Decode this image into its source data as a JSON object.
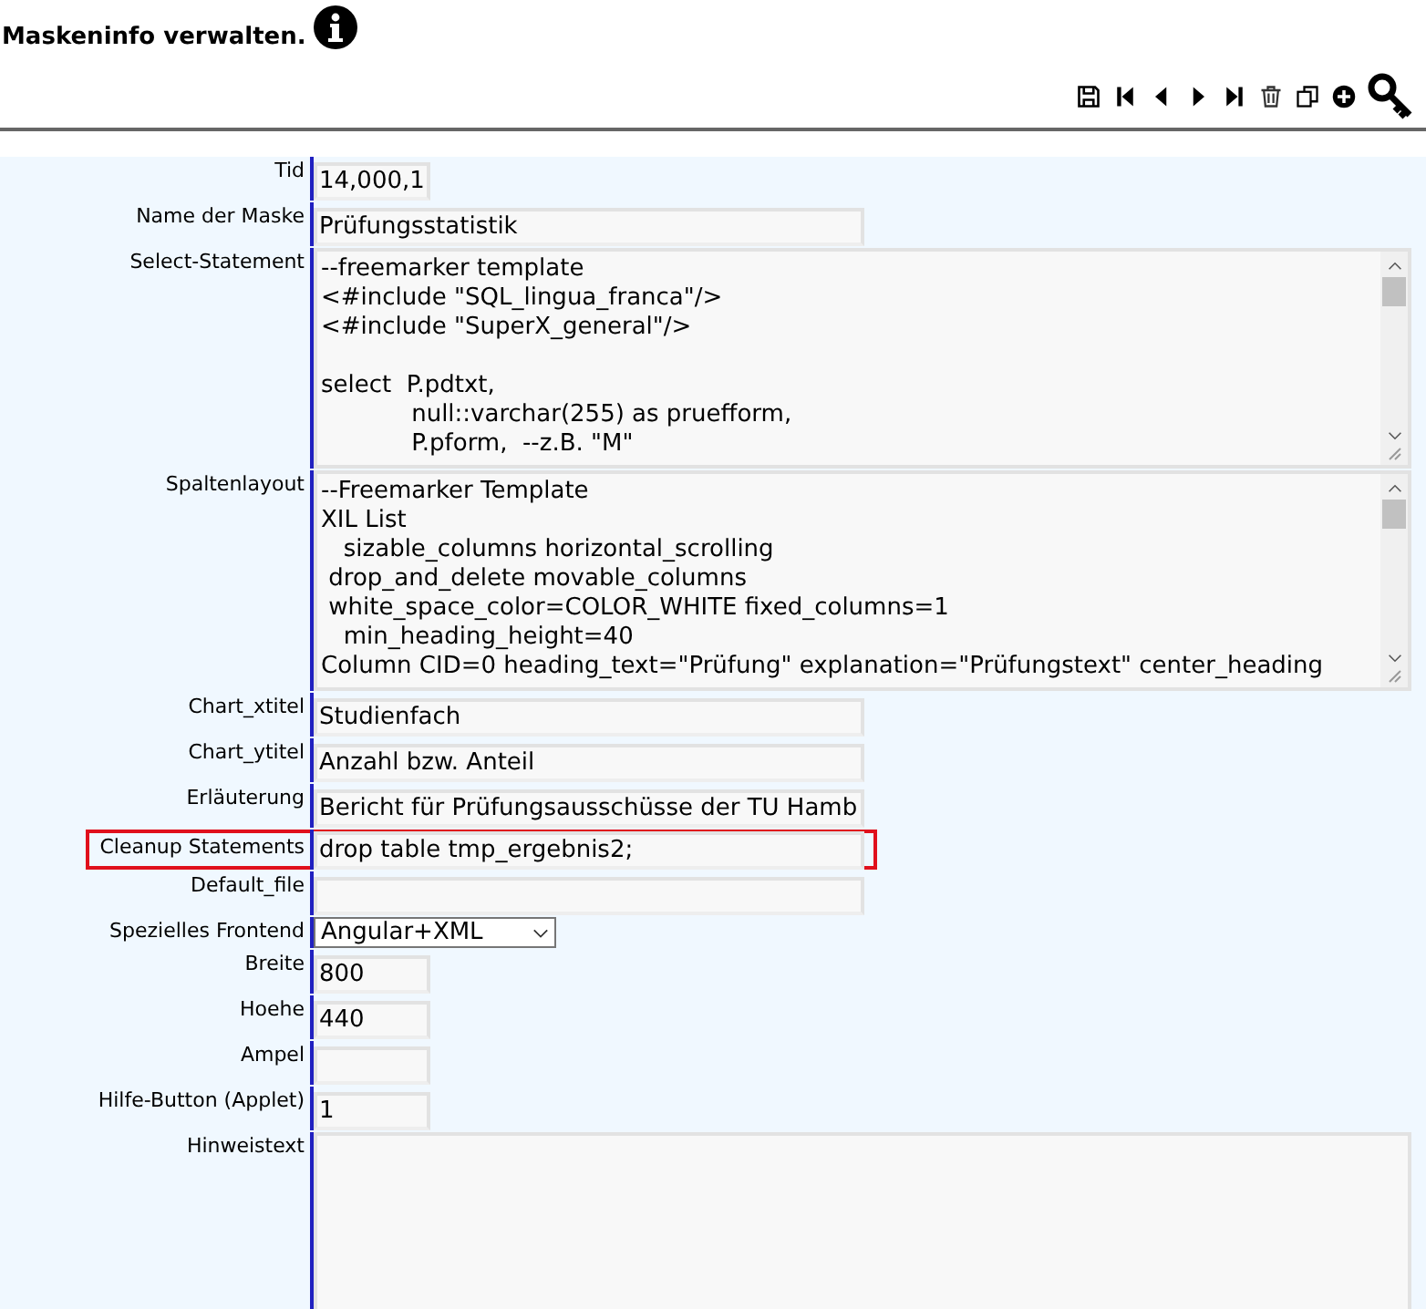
{
  "title": "Maskeninfo verwalten.",
  "fields": [
    {
      "label": "Tid",
      "kind": "short",
      "value": "14,000,1",
      "highlighted": false
    },
    {
      "label": "Name der Maske",
      "kind": "text",
      "value": "Prüfungsstatistik",
      "highlighted": false
    },
    {
      "label": "Select-Statement",
      "kind": "textarea",
      "blocks": [
        [
          "--freemarker template",
          "<#include \"SQL_lingua_franca\"/>",
          "<#include \"SuperX_general\"/>"
        ],
        [
          "select  P.pdtxt,",
          "            null::varchar(255) as pruefform,",
          "            P.pform,  --z.B. \"M\""
        ]
      ],
      "highlighted": false
    },
    {
      "label": "Spaltenlayout",
      "kind": "textarea",
      "blocks": [
        [
          "--Freemarker Template",
          "XIL List",
          "   sizable_columns horizontal_scrolling",
          " drop_and_delete movable_columns",
          " white_space_color=COLOR_WHITE fixed_columns=1",
          "   min_heading_height=40",
          "Column CID=0 heading_text=\"Prüfung\" explanation=\"Prüfungstext\" center_heading"
        ]
      ],
      "highlighted": false
    },
    {
      "label": "Chart_xtitel",
      "kind": "text",
      "value": "Studienfach",
      "highlighted": false
    },
    {
      "label": "Chart_ytitel",
      "kind": "text",
      "value": "Anzahl bzw. Anteil",
      "highlighted": false
    },
    {
      "label": "Erläuterung",
      "kind": "text",
      "value": "Bericht für Prüfungsausschüsse der TU Hamb",
      "highlighted": false
    },
    {
      "label": "Cleanup Statements",
      "kind": "text",
      "value": "drop table tmp_ergebnis2;",
      "highlighted": true
    },
    {
      "label": "Default_file",
      "kind": "text",
      "highlighted": false
    },
    {
      "label": "Spezielles Frontend",
      "kind": "select",
      "value": "Angular+XML",
      "highlighted": false
    },
    {
      "label": "Breite",
      "kind": "short",
      "value": "800",
      "highlighted": false
    },
    {
      "label": "Hoehe",
      "kind": "short",
      "value": "440",
      "highlighted": false
    },
    {
      "label": "Ampel",
      "kind": "short",
      "highlighted": false
    },
    {
      "label": "Hilfe-Button (Applet)",
      "kind": "short",
      "value": "1",
      "highlighted": false
    },
    {
      "label": "Hinweistext",
      "kind": "textarea",
      "highlighted": false
    }
  ]
}
